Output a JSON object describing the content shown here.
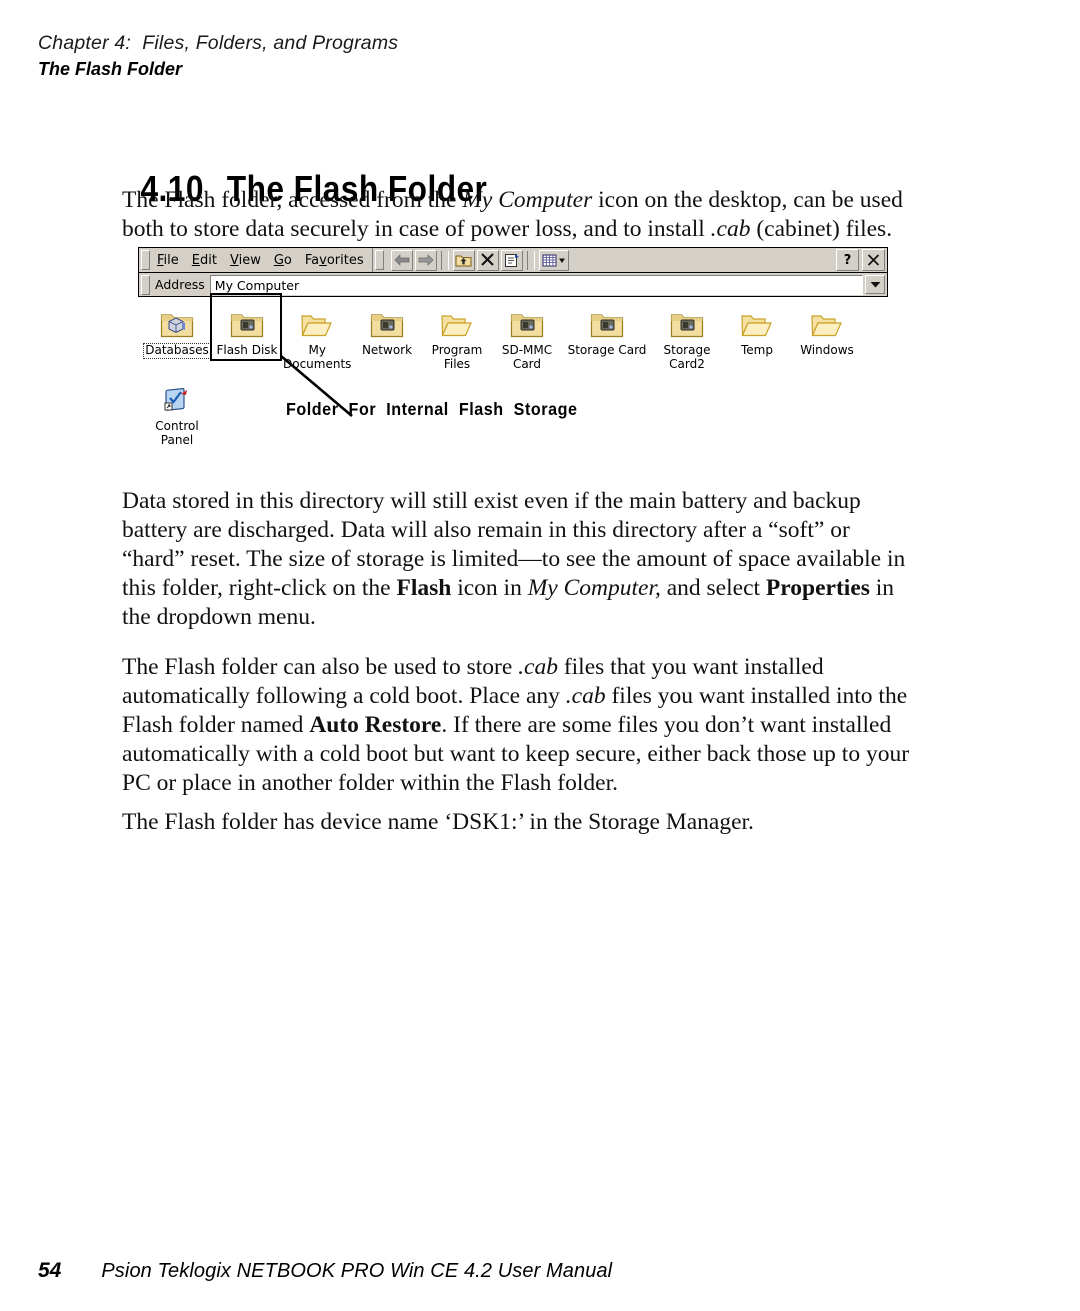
{
  "running_head": {
    "chapter": "Chapter 4:  Files, Folders, and Programs",
    "section": "The Flash Folder"
  },
  "heading": {
    "number": "4.10",
    "title": "The Flash Folder"
  },
  "paragraphs": {
    "intro_1": "The Flash folder, accessed from the ",
    "intro_italic_1": "My Computer",
    "intro_2": " icon on the desktop, can be used both to store data securely in case of power loss, and to install ",
    "intro_italic_2": ".cab",
    "intro_3": " (cabinet) files.",
    "p2_1": "Data stored in this directory will still exist even if the main battery and backup battery are discharged. Data will also remain in this directory after a “soft” or “hard” reset. The size of storage is limited—to see the amount of space available in this folder, right-click on the ",
    "p2_bold_1": "Flash",
    "p2_2": " icon in ",
    "p2_italic_1": "My Computer,",
    "p2_3": " and select ",
    "p2_bold_2": "Properties",
    "p2_4": " in the dropdown menu.",
    "p3_1": "The Flash folder can also be used to store ",
    "p3_italic_1": ".cab",
    "p3_2": " files that you want installed automatically following a cold boot. Place any ",
    "p3_italic_2": ".cab",
    "p3_3": " files you want installed into the Flash folder named ",
    "p3_bold_1": "Auto Restore",
    "p3_4": ". If there are some files you don’t want installed automatically with a cold boot but want to keep secure, either back those up to your PC or place in another folder within the Flash folder.",
    "p4": "The Flash folder has device name ‘DSK1:’ in the Storage Manager."
  },
  "ce_window": {
    "menu": [
      {
        "label": "File",
        "mnemonic": "F",
        "rest": "ile"
      },
      {
        "label": "Edit",
        "mnemonic": "E",
        "rest": "dit"
      },
      {
        "label": "View",
        "mnemonic": "V",
        "rest": "iew"
      },
      {
        "label": "Go",
        "mnemonic": "G",
        "rest": "o"
      },
      {
        "label": "Favorites",
        "pre": "Fa",
        "mnemonic": "v",
        "rest": "orites"
      }
    ],
    "toolbar_buttons": [
      "back-arrow-icon",
      "forward-arrow-icon",
      "up-one-level-icon",
      "delete-icon",
      "properties-icon",
      "views-dropdown-icon"
    ],
    "window_buttons": [
      {
        "name": "help-button",
        "label": "?"
      },
      {
        "name": "close-button",
        "label": "×"
      }
    ],
    "address": {
      "label": "Address",
      "value": "My Computer"
    },
    "icons_row1": [
      {
        "name": "Databases",
        "type": "databases",
        "selected": true
      },
      {
        "name": "Flash Disk",
        "type": "disk",
        "selected": false
      },
      {
        "name": "My\nDocuments",
        "type": "open-folder",
        "selected": false
      },
      {
        "name": "Network",
        "type": "disk",
        "selected": false
      },
      {
        "name": "Program Files",
        "type": "open-folder",
        "selected": false
      },
      {
        "name": "SD-MMC\nCard",
        "type": "disk",
        "selected": false
      },
      {
        "name": "Storage Card",
        "type": "disk",
        "selected": false
      },
      {
        "name": "Storage\nCard2",
        "type": "disk",
        "selected": false
      },
      {
        "name": "Temp",
        "type": "open-folder",
        "selected": false
      },
      {
        "name": "Windows",
        "type": "open-folder",
        "selected": false
      }
    ],
    "icons_row2": [
      {
        "name": "Control\nPanel",
        "type": "control-panel",
        "selected": false
      }
    ],
    "callout": "Folder  For  Internal  Flash  Storage"
  },
  "footer": {
    "page_number": "54",
    "manual_title": "Psion Teklogix NETBOOK PRO Win CE 4.2 User Manual"
  },
  "colors": {
    "chrome": "#d4d0c8",
    "folder_body": "#f2dea0",
    "folder_edge": "#c9a227",
    "page": "#ffffff",
    "text": "#000000"
  }
}
